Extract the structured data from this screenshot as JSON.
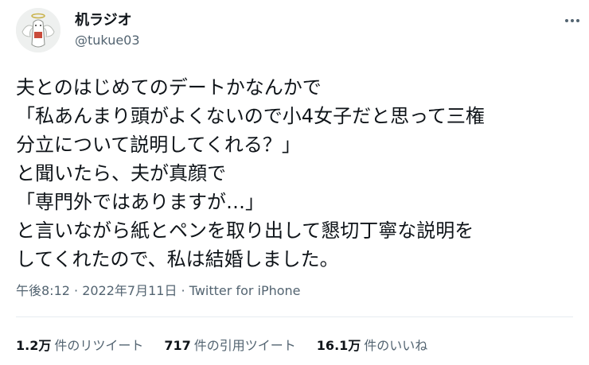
{
  "user": {
    "display_name": "机ラジオ",
    "handle": "@tukue03"
  },
  "tweet": {
    "lines": [
      "夫とのはじめてのデートかなんかで",
      "「私あんまり頭がよくないので小4女子だと思って三権",
      "分立について説明してくれる？」",
      "と聞いたら、夫が真顔で",
      "「専門外ではありますが…」",
      "と言いながら紙とペンを取り出して懇切丁寧な説明を",
      "してくれたので、私は結婚しました。"
    ],
    "timestamp": "午後8:12 · 2022年7月11日 · ",
    "source": "Twitter for iPhone"
  },
  "stats": {
    "retweets_count": "1.2万",
    "retweets_label": "件のリツイート",
    "quotes_count": "717",
    "quotes_label": "件の引用ツイート",
    "likes_count": "16.1万",
    "likes_label": "件のいいね"
  },
  "icons": {
    "more": "more-dots-icon"
  },
  "colors": {
    "text": "#0f1419",
    "secondary": "#536471",
    "divider": "#e6ecf0"
  }
}
